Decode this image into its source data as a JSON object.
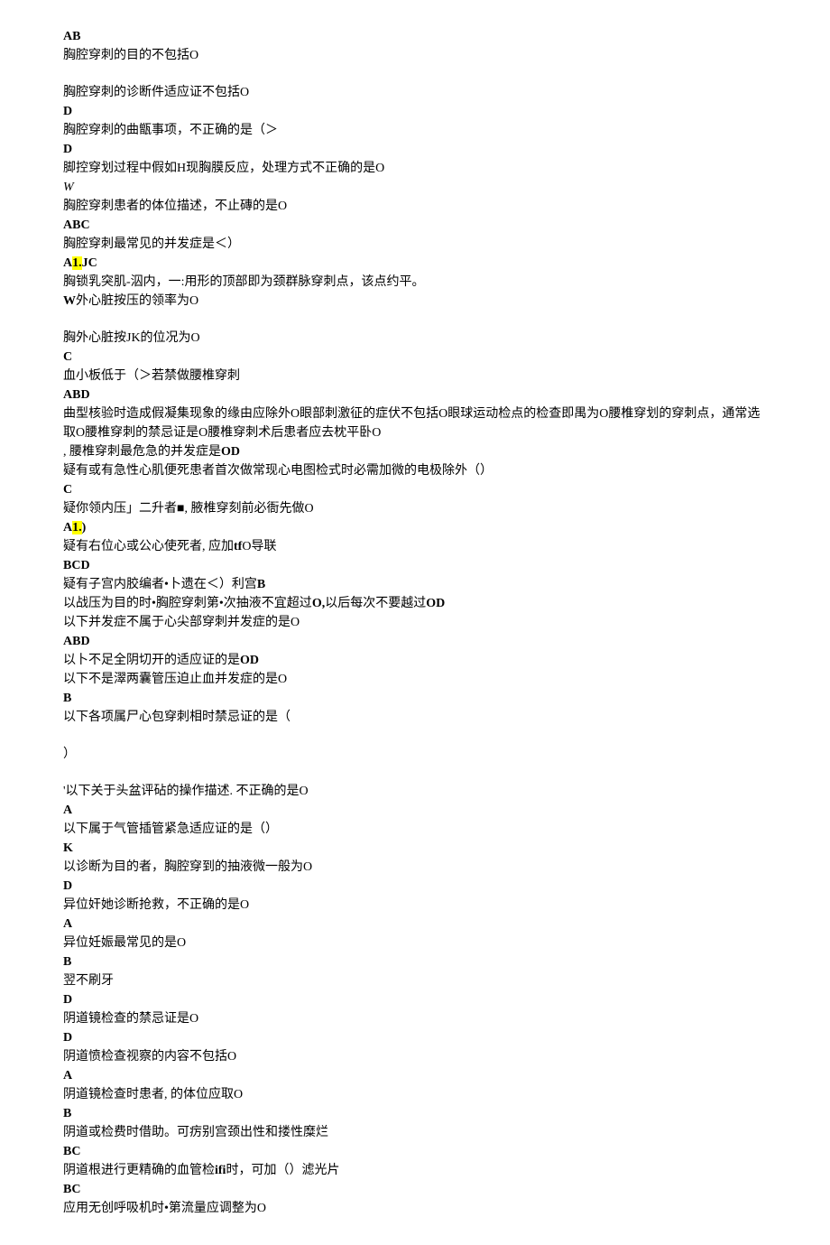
{
  "lines": [
    {
      "cls": "bold",
      "text": "AB"
    },
    {
      "cls": "",
      "text": "胸腔穿刺的目的不包括O"
    },
    {
      "cls": "blank",
      "text": ""
    },
    {
      "cls": "",
      "text": "胸腔穿刺的诊断件适应证不包括O"
    },
    {
      "cls": "bold",
      "text": "D"
    },
    {
      "cls": "",
      "text": "胸腔穿刺的曲甑事项，不正确的是（＞"
    },
    {
      "cls": "bold",
      "text": "D"
    },
    {
      "cls": "",
      "text": "脚控穿划过程中假如H现胸膜反应，处理方式不正确的是O"
    },
    {
      "cls": "italic",
      "text": "W"
    },
    {
      "cls": "",
      "text": "胸腔穿刺患者的体位描述，不止磚的是O"
    },
    {
      "cls": "bold",
      "text": "ABC"
    },
    {
      "cls": "",
      "text": "胸腔穿刺最常见的并发症是＜）"
    },
    {
      "cls": "bold",
      "text": "A<span class=\"hl\">1.</span>JC"
    },
    {
      "cls": "",
      "text": "胸锁乳突肌-泅内，一:用形的顶部即为颈群脉穿刺点，该点约平。"
    },
    {
      "cls": "",
      "text": "<span class=\"bold\">W</span>外心脏按压的领率为O"
    },
    {
      "cls": "blank",
      "text": ""
    },
    {
      "cls": "",
      "text": "胸外心脏按JK的位况为O"
    },
    {
      "cls": "bold",
      "text": "C"
    },
    {
      "cls": "",
      "text": "血小板低于（＞若禁做腰椎穿刺"
    },
    {
      "cls": "bold",
      "text": "ABD"
    },
    {
      "cls": "",
      "text": "曲型核验时造成假凝集现象的缘由应除外O眼部刺激征的症伏不包括O眼球运动检点的检查即禺为O腰椎穿划的穿刺点，通常选取O腰椎穿刺的禁忌证是O腰椎穿刺术后患者应去枕平卧O"
    },
    {
      "cls": "",
      "text": ", 腰椎穿刺最危急的并发症是<span class=\"bold\">OD</span>"
    },
    {
      "cls": "",
      "text": "疑有或有急性心肌便死患者首次做常现心电图检式时必需加微的电极除外（）"
    },
    {
      "cls": "bold",
      "text": "C"
    },
    {
      "cls": "",
      "text": "疑你领内压」二升者■, 腋椎穿刻前必衙先做O"
    },
    {
      "cls": "bold",
      "text": "A<span class=\"hl\">1.</span>)"
    },
    {
      "cls": "",
      "text": "疑有右位心或公心使死者, 应加<span class=\"bold\">tf</span>O导联"
    },
    {
      "cls": "bold",
      "text": "BCD"
    },
    {
      "cls": "",
      "text": "疑有子宫内胶编者•卜遗在＜）利宫<span class=\"bold\">B</span>"
    },
    {
      "cls": "",
      "text": "以战压为目的时•胸腔穿刺第•次抽液不宜超过<span class=\"bold\">O,</span>以后每次不要越过<span class=\"bold\">OD</span>"
    },
    {
      "cls": "",
      "text": "以下并发症不属于心尖部穿刺并发症的是O"
    },
    {
      "cls": "bold",
      "text": "ABD"
    },
    {
      "cls": "",
      "text": "以卜不足全阴切开的适应证的是<span class=\"bold\">OD</span>"
    },
    {
      "cls": "",
      "text": "以下不是濢两囊管压迫止血并发症的是O"
    },
    {
      "cls": "bold",
      "text": "B"
    },
    {
      "cls": "",
      "text": "以下各项属尸心包穿刺相时禁忌证的是（"
    },
    {
      "cls": "blank",
      "text": ""
    },
    {
      "cls": "",
      "text": "）"
    },
    {
      "cls": "blank",
      "text": ""
    },
    {
      "cls": "",
      "text": "'以下关于头盆评砧的操作描述. 不正确的是O"
    },
    {
      "cls": "bold",
      "text": "A"
    },
    {
      "cls": "",
      "text": "以下属于气管插管紧急适应证的是（）"
    },
    {
      "cls": "bold",
      "text": "K"
    },
    {
      "cls": "",
      "text": "以诊断为目的者，胸腔穿到的抽液微一般为O"
    },
    {
      "cls": "bold",
      "text": "D"
    },
    {
      "cls": "",
      "text": "异位奸她诊断抢救，不正确的是O"
    },
    {
      "cls": "bold",
      "text": "A"
    },
    {
      "cls": "",
      "text": "异位妊娠最常见的是O"
    },
    {
      "cls": "bold",
      "text": "B"
    },
    {
      "cls": "",
      "text": "翌不刷牙"
    },
    {
      "cls": "bold",
      "text": "D"
    },
    {
      "cls": "",
      "text": "阴道镜检查的禁忌证是O"
    },
    {
      "cls": "bold",
      "text": "D"
    },
    {
      "cls": "",
      "text": "阴道愤检查视察的内容不包括O"
    },
    {
      "cls": "bold",
      "text": "A"
    },
    {
      "cls": "",
      "text": "阴道镜检查时患者, 的体位应取O"
    },
    {
      "cls": "bold",
      "text": "B"
    },
    {
      "cls": "",
      "text": "阴道或检费时借助。可疠别宫颈出性和搂性糜烂"
    },
    {
      "cls": "bold",
      "text": "BC"
    },
    {
      "cls": "",
      "text": "阴道根进行更精确的血管检<span class=\"bold\">ifi</span>时，可加（）滤光片"
    },
    {
      "cls": "bold",
      "text": "BC"
    },
    {
      "cls": "",
      "text": "应用无创呼吸机时•第流量应调整为O"
    }
  ]
}
